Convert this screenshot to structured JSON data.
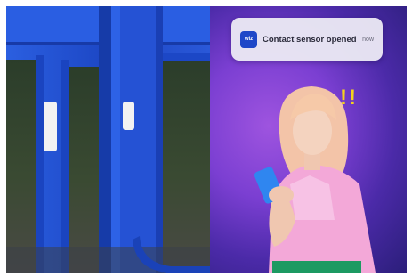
{
  "notification": {
    "app_name": "wiz",
    "title": "Contact sensor opened",
    "time": "now"
  },
  "alert_mark": "!!",
  "colors": {
    "door_blue": "#1f4fd0",
    "background_purple": "#7b3fd2",
    "alert_yellow": "#f5d21c",
    "sensor_white": "#f2f2f2"
  }
}
